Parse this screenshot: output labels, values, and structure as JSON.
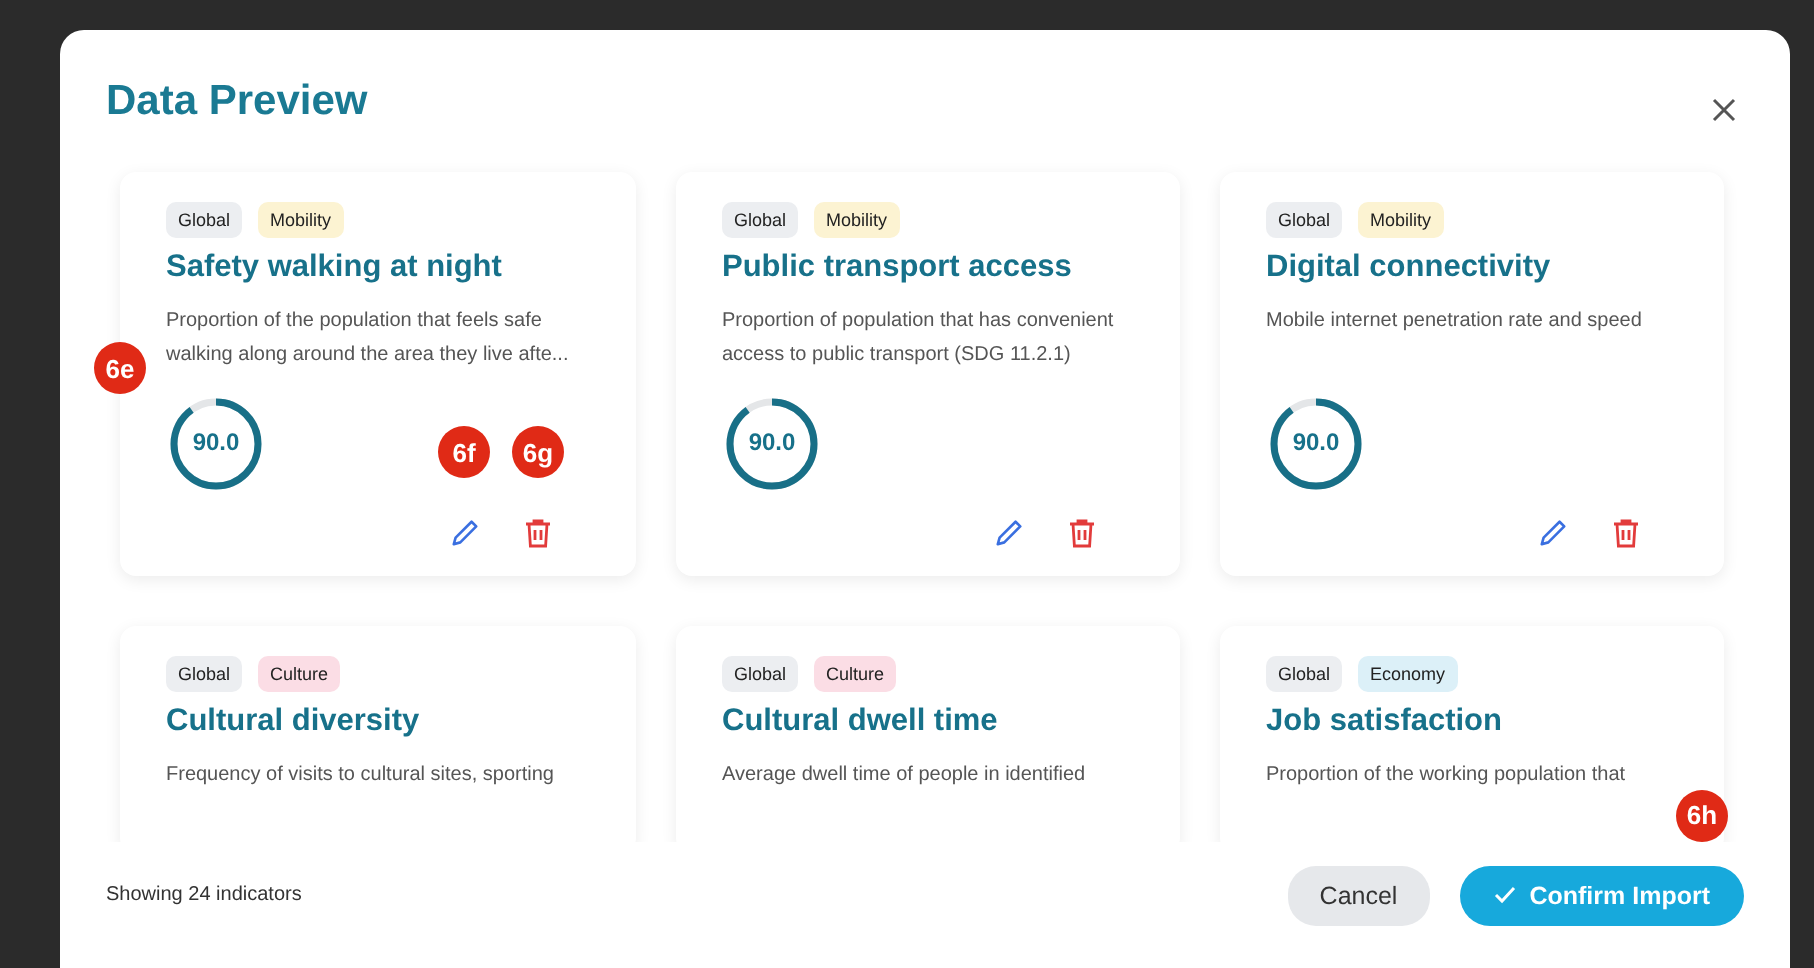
{
  "dialog": {
    "title": "Data Preview"
  },
  "cards": [
    {
      "tags": [
        {
          "label": "Global",
          "color": "#eceef1"
        },
        {
          "label": "Mobility",
          "color": "#fcf3d2"
        }
      ],
      "title": "Safety walking at night",
      "description": "Proportion of the population that feels safe walking along around the area they live afte...",
      "score": "90.0",
      "level": 0.9,
      "markers": {
        "card": "6e",
        "edit": "6f",
        "delete": "6g"
      }
    },
    {
      "tags": [
        {
          "label": "Global",
          "color": "#eceef1"
        },
        {
          "label": "Mobility",
          "color": "#fcf3d2"
        }
      ],
      "title": "Public transport access",
      "description": "Proportion of population that has convenient access to public transport (SDG 11.2.1)",
      "score": "90.0",
      "level": 0.9
    },
    {
      "tags": [
        {
          "label": "Global",
          "color": "#eceef1"
        },
        {
          "label": "Mobility",
          "color": "#fcf3d2"
        }
      ],
      "title": "Digital connectivity",
      "description": "Mobile internet penetration rate and speed",
      "score": "90.0",
      "level": 0.9
    },
    {
      "tags": [
        {
          "label": "Global",
          "color": "#eceef1"
        },
        {
          "label": "Culture",
          "color": "#fbdde5"
        }
      ],
      "title": "Cultural diversity",
      "description": "Frequency of visits to cultural sites, sporting"
    },
    {
      "tags": [
        {
          "label": "Global",
          "color": "#eceef1"
        },
        {
          "label": "Culture",
          "color": "#fbdde5"
        }
      ],
      "title": "Cultural dwell time",
      "description": "Average dwell time of people in identified"
    },
    {
      "tags": [
        {
          "label": "Global",
          "color": "#eceef1"
        },
        {
          "label": "Economy",
          "color": "#dcf0f8"
        }
      ],
      "title": "Job satisfaction",
      "description": "Proportion of the working population that"
    }
  ],
  "footer": {
    "count_text": "Showing 24 indicators",
    "cancel": "Cancel",
    "confirm": "Confirm Import",
    "confirm_marker": "6h"
  }
}
